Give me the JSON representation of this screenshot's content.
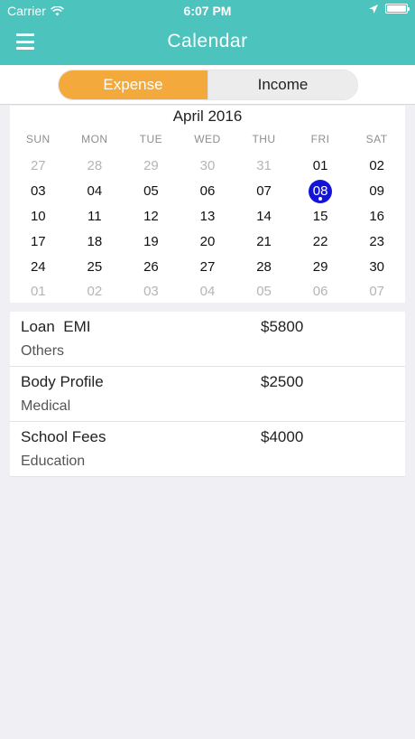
{
  "status_bar": {
    "carrier": "Carrier",
    "time": "6:07 PM",
    "icons": [
      "wifi-icon",
      "location-arrow-icon",
      "battery-icon"
    ]
  },
  "nav": {
    "title": "Calendar",
    "menu_icon": "hamburger-menu-icon"
  },
  "segment": {
    "options": [
      "Expense",
      "Income"
    ],
    "selected": "Expense"
  },
  "calendar": {
    "month_title": "April 2016",
    "weekdays": [
      "SUN",
      "MON",
      "TUE",
      "WED",
      "THU",
      "FRI",
      "SAT"
    ],
    "selected_day": "08",
    "days": [
      {
        "label": "27",
        "muted": true
      },
      {
        "label": "28",
        "muted": true
      },
      {
        "label": "29",
        "muted": true
      },
      {
        "label": "30",
        "muted": true
      },
      {
        "label": "31",
        "muted": true
      },
      {
        "label": "01",
        "muted": false
      },
      {
        "label": "02",
        "muted": false
      },
      {
        "label": "03",
        "muted": false
      },
      {
        "label": "04",
        "muted": false
      },
      {
        "label": "05",
        "muted": false
      },
      {
        "label": "06",
        "muted": false
      },
      {
        "label": "07",
        "muted": false
      },
      {
        "label": "08",
        "muted": false
      },
      {
        "label": "09",
        "muted": false
      },
      {
        "label": "10",
        "muted": false
      },
      {
        "label": "11",
        "muted": false
      },
      {
        "label": "12",
        "muted": false
      },
      {
        "label": "13",
        "muted": false
      },
      {
        "label": "14",
        "muted": false
      },
      {
        "label": "15",
        "muted": false
      },
      {
        "label": "16",
        "muted": false
      },
      {
        "label": "17",
        "muted": false
      },
      {
        "label": "18",
        "muted": false
      },
      {
        "label": "19",
        "muted": false
      },
      {
        "label": "20",
        "muted": false
      },
      {
        "label": "21",
        "muted": false
      },
      {
        "label": "22",
        "muted": false
      },
      {
        "label": "23",
        "muted": false
      },
      {
        "label": "24",
        "muted": false
      },
      {
        "label": "25",
        "muted": false
      },
      {
        "label": "26",
        "muted": false
      },
      {
        "label": "27",
        "muted": false
      },
      {
        "label": "28",
        "muted": false
      },
      {
        "label": "29",
        "muted": false
      },
      {
        "label": "30",
        "muted": false
      },
      {
        "label": "01",
        "muted": true
      },
      {
        "label": "02",
        "muted": true
      },
      {
        "label": "03",
        "muted": true
      },
      {
        "label": "04",
        "muted": true
      },
      {
        "label": "05",
        "muted": true
      },
      {
        "label": "06",
        "muted": true
      },
      {
        "label": "07",
        "muted": true
      }
    ]
  },
  "transactions": [
    {
      "title": "Loan  EMI",
      "amount": "$5800",
      "category": "Others"
    },
    {
      "title": "Body Profile",
      "amount": "$2500",
      "category": "Medical"
    },
    {
      "title": "School Fees",
      "amount": "$4000",
      "category": "Education"
    }
  ],
  "colors": {
    "header": "#4cc3bd",
    "expense_segment": "#f3a93b",
    "selected_day": "#1414d8",
    "background": "#efeff4"
  }
}
